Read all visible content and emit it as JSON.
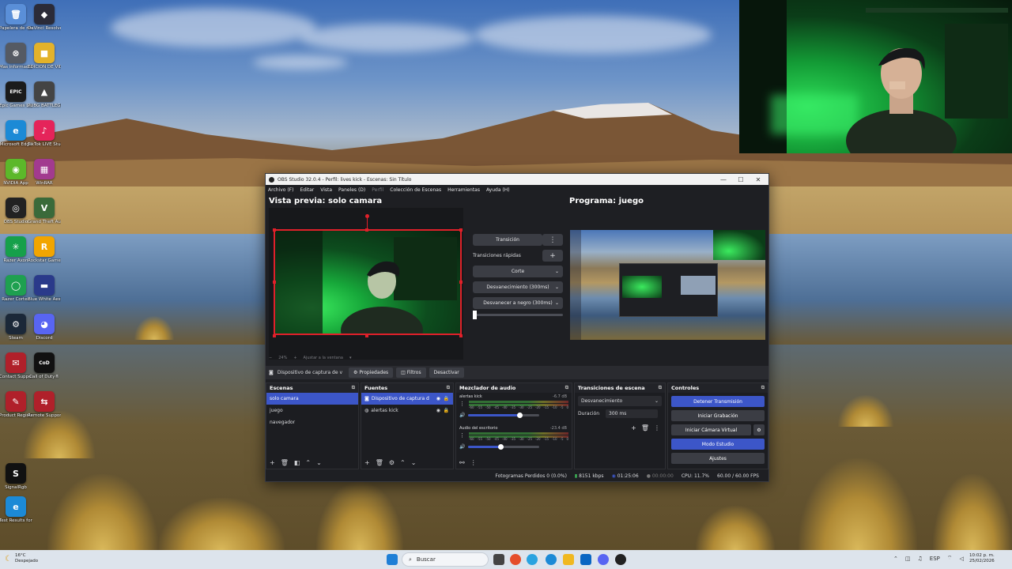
{
  "desktop": {
    "icons": [
      {
        "label": "Papelera de reciclaje",
        "color": "#5a8fd8",
        "glyph": "🗑"
      },
      {
        "label": "DaVinci Resolve",
        "color": "#2b2b38",
        "glyph": "◆"
      },
      {
        "label": "Mas informacion...",
        "color": "#555a63",
        "glyph": "⊗"
      },
      {
        "label": "EDICION DE VIDEOS OKS",
        "color": "#e3b22a",
        "glyph": "■"
      },
      {
        "label": "Epic Games Launcher",
        "color": "#1b1b1b",
        "glyph": "EPIC"
      },
      {
        "label": "PUBG BATTLEGR...",
        "color": "#444",
        "glyph": "▲"
      },
      {
        "label": "Microsoft Edge",
        "color": "#1c8ad6",
        "glyph": "e"
      },
      {
        "label": "TikTok LIVE Studio",
        "color": "#e5245a",
        "glyph": "♪"
      },
      {
        "label": "NVIDIA App",
        "color": "#5cb82a",
        "glyph": "◉"
      },
      {
        "label": "WinRAR",
        "color": "#a23a8f",
        "glyph": "▦"
      },
      {
        "label": "OBS Studio",
        "color": "#222",
        "glyph": "◎"
      },
      {
        "label": "Grand Theft Auto V",
        "color": "#3a6a3a",
        "glyph": "V"
      },
      {
        "label": "Razer Axon",
        "color": "#16a04a",
        "glyph": "✳"
      },
      {
        "label": "Rockstar Games...",
        "color": "#f2a500",
        "glyph": "R"
      },
      {
        "label": "Razer Cortex",
        "color": "#1ea050",
        "glyph": "◯"
      },
      {
        "label": "Blue White Aesthetic...",
        "color": "#2a3a8a",
        "glyph": "▬"
      },
      {
        "label": "Steam",
        "color": "#1b2838",
        "glyph": "⚙"
      },
      {
        "label": "Discord",
        "color": "#5865f2",
        "glyph": "◕"
      },
      {
        "label": "Contact Support",
        "color": "#b0202a",
        "glyph": "✉"
      },
      {
        "label": "Call of Duty®",
        "color": "#111",
        "glyph": "CoD"
      },
      {
        "label": "Product Registration",
        "color": "#b0202a",
        "glyph": "✎"
      },
      {
        "label": "Remote Support",
        "color": "#b0202a",
        "glyph": "⇆"
      },
      {
        "label": "SignalRgb",
        "color": "#111",
        "glyph": "S"
      },
      {
        "label": "Test Results for ST-800...",
        "color": "#1c8ad6",
        "glyph": "e"
      }
    ]
  },
  "obs": {
    "title": "OBS Studio 32.0.4 - Perfil: lives kick - Escenas: Sin Título",
    "menu": [
      "Archivo (F)",
      "Editar",
      "Vista",
      "Paneles (D)",
      "Perfil",
      "Colección de Escenas",
      "Herramientas",
      "Ayuda (H)"
    ],
    "preview_header": "Vista previa: solo camara",
    "program_header": "Programa: juego",
    "transition_button": "Transición",
    "quick_transitions_label": "Transiciones rápidas",
    "quick_transitions": [
      "Corte",
      "Desvanecimiento (300ms)",
      "Desvanecer a negro (300ms)"
    ],
    "zoom_percent": "24%",
    "zoom_fit": "Ajustar a la ventana",
    "source_toolbar": {
      "selected_source": "Dispositivo de captura de v",
      "properties": "Propiedades",
      "filters": "Filtros",
      "deactivate": "Desactivar"
    },
    "scenes": {
      "title": "Escenas",
      "items": [
        "solo camara",
        "juego",
        "navegador"
      ],
      "selected_index": 0
    },
    "sources": {
      "title": "Fuentes",
      "items": [
        "Dispositivo de captura d",
        "alertas kick"
      ]
    },
    "mixer": {
      "title": "Mezclador de audio",
      "channels": [
        {
          "name": "alertas kick",
          "level": "-6.7 dB",
          "volume": 0.72
        },
        {
          "name": "Audio del escritorio",
          "level": "-23.4 dB",
          "volume": 0.45
        }
      ],
      "ticks": [
        "-60",
        "-55",
        "-50",
        "-45",
        "-40",
        "-35",
        "-30",
        "-25",
        "-20",
        "-15",
        "-10",
        "-5",
        "0"
      ]
    },
    "scene_transitions": {
      "title": "Transiciones de escena",
      "selected": "Desvanecimiento",
      "duration_label": "Duración",
      "duration_value": "300 ms"
    },
    "controls": {
      "title": "Controles",
      "stop_stream": "Detener Transmisión",
      "start_recording": "Iniciar Grabación",
      "start_virtual_cam": "Iniciar Cámara Virtual",
      "studio_mode": "Modo Estudio",
      "settings": "Ajustes"
    },
    "status": {
      "dropped_frames": "Fotogramas Perdidos 0 (0.0%)",
      "bitrate": "8151 kbps",
      "stream_time": "01:25:06",
      "rec_time": "00:00:00",
      "cpu": "CPU: 11.7%",
      "fps": "60.00 / 60.00 FPS"
    }
  },
  "taskbar": {
    "weather_temp": "16°C",
    "weather_desc": "Despejado",
    "search_placeholder": "Buscar",
    "language": "ESP",
    "time": "10:02 p. m.",
    "date": "25/02/2026"
  },
  "colors": {
    "accent_blue": "#3c56c8",
    "obs_bg": "#1e1f23",
    "preview_border": "#e0202a"
  }
}
